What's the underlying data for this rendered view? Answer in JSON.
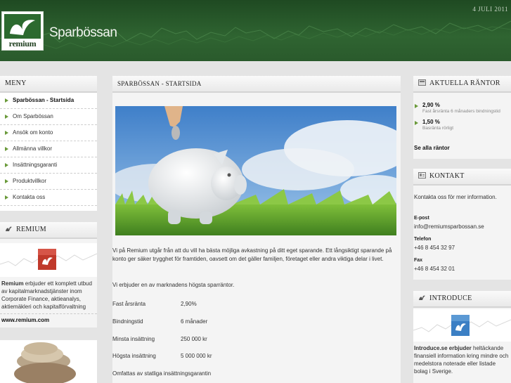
{
  "header": {
    "site_title": "Sparbössan",
    "logo_text": "remium",
    "date": "4 JULI 2011"
  },
  "menu": {
    "title": "MENY",
    "items": [
      {
        "label": "Sparbössan - Startsida",
        "active": true
      },
      {
        "label": "Om Sparbössan"
      },
      {
        "label": "Ansök om konto"
      },
      {
        "label": "Allmänna villkor"
      },
      {
        "label": "Insättningsgaranti"
      },
      {
        "label": "Produktvillkor"
      },
      {
        "label": "Kontakta oss"
      }
    ]
  },
  "remium_box": {
    "title": "REMIUM",
    "text_bold": "Remium",
    "text": " erbjuder ett komplett utbud av kapitalmarknadstjänster inom Corporate Finance, aktieanalys, aktiemäkleri och kapitalförvaltning",
    "link": "www.remium.com"
  },
  "main": {
    "title": "SPARBÖSSAN - STARTSIDA",
    "intro": "Vi på Remium utgår från att du vill ha bästa möjliga avkastning på ditt eget sparande. Ett långsiktigt sparande på konto ger säker trygghet för framtiden, oavsett om det gäller familjen, företaget eller andra viktiga delar i livet.",
    "offer": "Vi erbjuder en av marknadens högsta sparräntor.",
    "rows": [
      {
        "label": "Fast årsränta",
        "value": "2,90%"
      },
      {
        "label": "Bindningstid",
        "value": "6 månader"
      },
      {
        "label": "Minsta insättning",
        "value": "250 000 kr"
      },
      {
        "label": "Högsta insättning",
        "value": "5 000 000 kr"
      }
    ],
    "note": "Omfattas av statliga insättningsgarantin"
  },
  "rates": {
    "title": "AKTUELLA RÄNTOR",
    "items": [
      {
        "value": "2,90 %",
        "desc": "Fast årsränta 6 månaders bindningstid"
      },
      {
        "value": "1,50 %",
        "desc": "Basränta rörligt"
      }
    ],
    "all_link": "Se alla räntor"
  },
  "contact": {
    "title": "KONTAKT",
    "intro": "Kontakta oss för mer information.",
    "email_label": "E-post",
    "email": "info@remiumsparbossan.se",
    "phone_label": "Telefon",
    "phone": "+46 8 454 32 97",
    "fax_label": "Fax",
    "fax": "+46 8 454 32 01"
  },
  "introduce": {
    "title": "INTRODUCE",
    "text_bold": "Introduce.se erbjuder",
    "text": " heltäckande finansiell information kring mindre och medelstora noterade eller listade bolag i Sverige."
  },
  "colors": {
    "header_green": "#2f6431",
    "accent_green": "#6a9a3a",
    "remium_red": "#c0392b",
    "introduce_blue": "#3b7fc4"
  }
}
